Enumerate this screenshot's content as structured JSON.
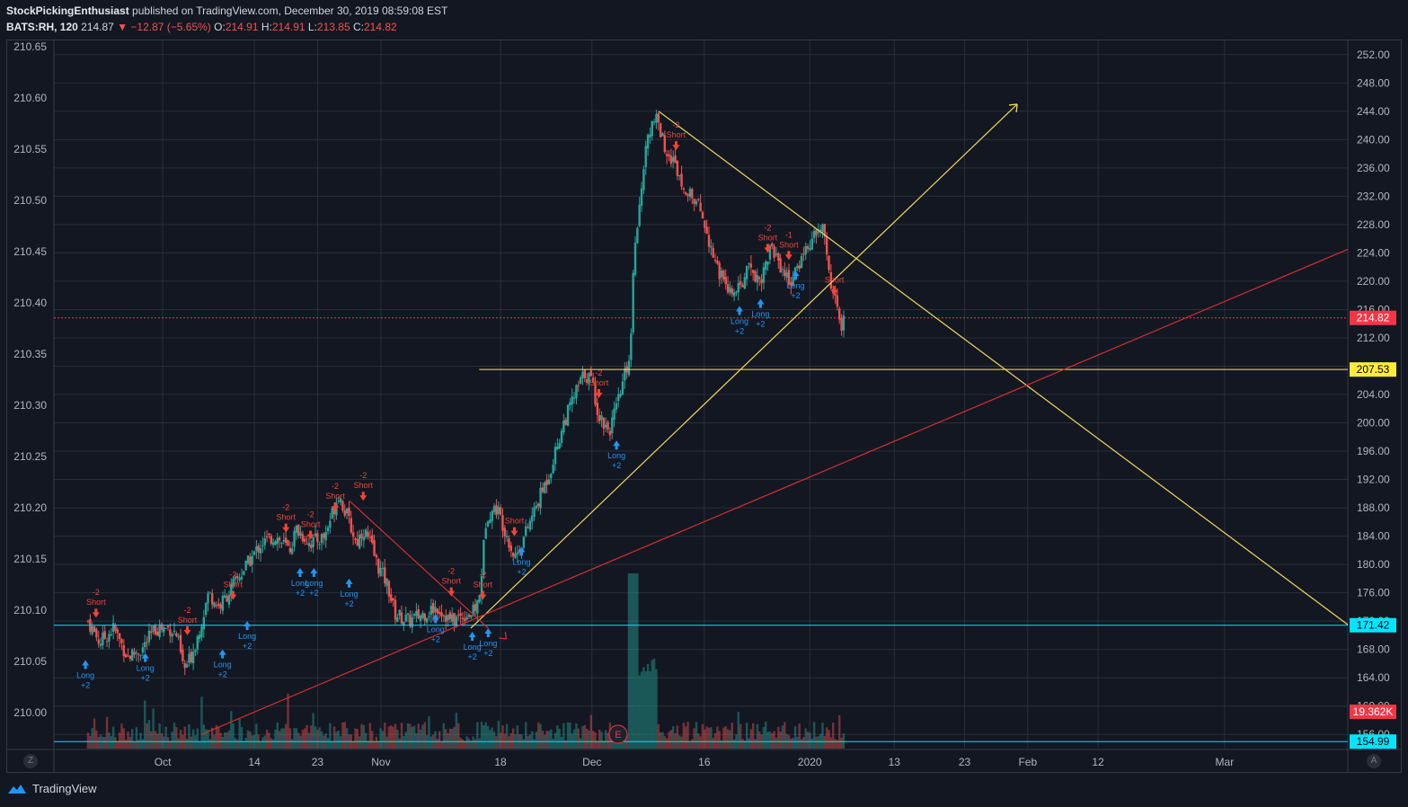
{
  "header": {
    "author": "StockPickingEnthusiast",
    "published_text": "published on TradingView.com, December 30, 2019 08:59:08 EST",
    "symbol": "BATS:RH, 120",
    "last": "214.87",
    "change": "▼ −12.87 (−5.65%)",
    "o_label": "O:",
    "o": "214.91",
    "h_label": "H:",
    "h": "214.91",
    "l_label": "L:",
    "l": "213.85",
    "c_label": "C:",
    "c": "214.82"
  },
  "footer": {
    "brand": "TradingView",
    "z_button": "Z",
    "a_button": "A"
  },
  "colors": {
    "background": "#131722",
    "grid": "#2a2e39",
    "up": "#26a69a",
    "down": "#ef5350",
    "trend_yellow": "#f0d85b",
    "trend_red": "#d32f2f",
    "support_cyan": "#4dd0e1",
    "long_marker": "#2196f3",
    "short_marker": "#f44336"
  },
  "chart_data": {
    "type": "candlestick",
    "left_axis": {
      "ticks": [
        "210.65",
        "210.60",
        "210.55",
        "210.50",
        "210.45",
        "210.40",
        "210.35",
        "210.30",
        "210.25",
        "210.20",
        "210.15",
        "210.10",
        "210.05",
        "210.00"
      ]
    },
    "right_axis": {
      "ticks": [
        "252.00",
        "248.00",
        "244.00",
        "240.00",
        "236.00",
        "232.00",
        "228.00",
        "224.00",
        "220.00",
        "216.00",
        "212.00",
        "208.00",
        "204.00",
        "200.00",
        "196.00",
        "192.00",
        "188.00",
        "184.00",
        "180.00",
        "176.00",
        "172.00",
        "168.00",
        "164.00",
        "160.00",
        "156.00"
      ],
      "ylim": [
        154,
        254
      ],
      "price_labels": [
        {
          "text": "214.82",
          "value": 214.82,
          "color": "#f23645",
          "text_color": "#ffffff"
        },
        {
          "text": "207.53",
          "value": 207.53,
          "color": "#ffeb3b",
          "text_color": "#000000"
        },
        {
          "text": "171.42",
          "value": 171.42,
          "color": "#00e5ff",
          "text_color": "#000000"
        },
        {
          "text": "19.362K",
          "value": 159.2,
          "color": "#f23645",
          "text_color": "#ffffff"
        },
        {
          "text": "154.99",
          "value": 154.99,
          "color": "#00e5ff",
          "text_color": "#000000"
        }
      ]
    },
    "x_axis": {
      "labels": [
        "Oct",
        "14",
        "23",
        "Nov",
        "18",
        "Dec",
        "16",
        "2020",
        "13",
        "23",
        "Feb",
        "12",
        "Mar"
      ],
      "label_values": [
        2019.7479,
        2019.7836,
        2019.8082,
        2019.8329,
        2019.8795,
        2019.9151,
        2019.9589,
        2020.0,
        2020.0329,
        2020.0603,
        2020.0849,
        2020.1123,
        2020.1616
      ]
    },
    "ohlc_points": [
      [
        2019.7188,
        172
      ],
      [
        2019.7233,
        169
      ],
      [
        2019.7288,
        171
      ],
      [
        2019.7342,
        167
      ],
      [
        2019.7397,
        168
      ],
      [
        2019.7452,
        171
      ],
      [
        2019.7507,
        171
      ],
      [
        2019.7534,
        170
      ],
      [
        2019.7562,
        165
      ],
      [
        2019.7589,
        167
      ],
      [
        2019.7616,
        170
      ],
      [
        2019.7658,
        176
      ],
      [
        2019.7699,
        174
      ],
      [
        2019.7753,
        177
      ],
      [
        2019.7808,
        180
      ],
      [
        2019.7863,
        183
      ],
      [
        2019.7918,
        184
      ],
      [
        2019.7973,
        182
      ],
      [
        2019.8,
        185
      ],
      [
        2019.8055,
        183
      ],
      [
        2019.811,
        184
      ],
      [
        2019.8164,
        190
      ],
      [
        2019.8205,
        186
      ],
      [
        2019.8233,
        183
      ],
      [
        2019.826,
        185
      ],
      [
        2019.8288,
        183
      ],
      [
        2019.8315,
        180
      ],
      [
        2019.8356,
        177
      ],
      [
        2019.8384,
        173
      ],
      [
        2019.8438,
        172
      ],
      [
        2019.8493,
        173
      ],
      [
        2019.8548,
        174
      ],
      [
        2019.8603,
        172
      ],
      [
        2019.8658,
        173
      ],
      [
        2019.8685,
        173
      ],
      [
        2019.8712,
        175
      ],
      [
        2019.874,
        187
      ],
      [
        2019.8781,
        188
      ],
      [
        2019.8822,
        184
      ],
      [
        2019.8849,
        181
      ],
      [
        2019.8877,
        183
      ],
      [
        2019.8932,
        188
      ],
      [
        2019.8986,
        193
      ],
      [
        2019.9041,
        200
      ],
      [
        2019.9096,
        205
      ],
      [
        2019.9123,
        207
      ],
      [
        2019.9151,
        206
      ],
      [
        2019.9178,
        201
      ],
      [
        2019.9219,
        199
      ],
      [
        2019.9247,
        202
      ],
      [
        2019.9274,
        206
      ],
      [
        2019.9301,
        210
      ],
      [
        2019.9315,
        225
      ],
      [
        2019.9342,
        232
      ],
      [
        2019.937,
        241
      ],
      [
        2019.9397,
        243
      ],
      [
        2019.9438,
        239
      ],
      [
        2019.9479,
        236
      ],
      [
        2019.9534,
        232
      ],
      [
        2019.9575,
        230
      ],
      [
        2019.963,
        223
      ],
      [
        2019.9671,
        219
      ],
      [
        2019.9712,
        218
      ],
      [
        2019.9767,
        222
      ],
      [
        2019.9808,
        220
      ],
      [
        2019.9849,
        225
      ],
      [
        2019.989,
        222
      ],
      [
        2019.9918,
        220
      ],
      [
        2019.9945,
        221
      ],
      [
        2019.9973,
        224
      ],
      [
        2020.0014,
        226
      ],
      [
        2020.0055,
        228
      ],
      [
        2020.0068,
        222
      ],
      [
        2020.0096,
        218
      ],
      [
        2020.0123,
        213
      ],
      [
        2020.0137,
        215
      ]
    ],
    "trend_lines": [
      {
        "color": "#f0d85b",
        "from": [
          2019.8679,
          171.0
        ],
        "to": [
          2020.0808,
          245.0
        ]
      },
      {
        "color": "#f0d85b",
        "from": [
          2019.9411,
          244.0
        ],
        "to": [
          2020.2096,
          171.5
        ]
      },
      {
        "color": "#d32f2f",
        "from": [
          2019.763,
          156.0
        ],
        "to": [
          2020.2096,
          224.5
        ]
      },
      {
        "color": "#d32f2f",
        "from": [
          2019.8206,
          189.0
        ],
        "to": [
          2019.8747,
          171.0
        ]
      }
    ],
    "horizontal_levels": [
      {
        "value": 207.53,
        "color": "#ffeb3b",
        "from_x": 2019.8712,
        "dashed": false
      },
      {
        "value": 171.42,
        "color": "#00e5ff",
        "from_x": 2019.7055,
        "dashed": false
      },
      {
        "value": 214.82,
        "color": "#f23645",
        "from_x": 2019.7055,
        "dashed": true
      },
      {
        "value": 154.99,
        "color": "#00e5ff",
        "from_x": 2019.7055,
        "dashed": false
      }
    ],
    "signal_markers": [
      {
        "kind": "long",
        "x": 2019.7178,
        "value": 166.5,
        "labels": [
          "Long",
          "+2"
        ]
      },
      {
        "kind": "long",
        "x": 2019.7411,
        "value": 167.5,
        "labels": [
          "Long",
          "+2"
        ]
      },
      {
        "kind": "long",
        "x": 2019.7712,
        "value": 168.0,
        "labels": [
          "Long",
          "+2"
        ]
      },
      {
        "kind": "long",
        "x": 2019.7808,
        "value": 172.0,
        "labels": [
          "Long",
          "+2"
        ]
      },
      {
        "kind": "long",
        "x": 2019.8014,
        "value": 179.5,
        "labels": [
          "Long",
          "+2"
        ]
      },
      {
        "kind": "long",
        "x": 2019.8068,
        "value": 179.5,
        "labels": [
          "Long",
          "+2"
        ]
      },
      {
        "kind": "long",
        "x": 2019.8205,
        "value": 178.0,
        "labels": [
          "Long",
          "+2"
        ]
      },
      {
        "kind": "long",
        "x": 2019.8542,
        "value": 173.0,
        "labels": [
          "Long",
          "+2"
        ]
      },
      {
        "kind": "long",
        "x": 2019.8685,
        "value": 170.5,
        "labels": [
          "Long",
          "+2"
        ]
      },
      {
        "kind": "long",
        "x": 2019.8747,
        "value": 171.0,
        "labels": [
          "Long",
          "+2"
        ]
      },
      {
        "kind": "long",
        "x": 2019.8877,
        "value": 182.5,
        "labels": [
          "Long",
          "+2"
        ]
      },
      {
        "kind": "long",
        "x": 2019.9247,
        "value": 197.5,
        "labels": [
          "Long",
          "+2"
        ]
      },
      {
        "kind": "long",
        "x": 2019.9726,
        "value": 216.5,
        "labels": [
          "Long",
          "+2"
        ]
      },
      {
        "kind": "long",
        "x": 2019.9808,
        "value": 217.5,
        "labels": [
          "Long",
          "+2"
        ]
      },
      {
        "kind": "long",
        "x": 2019.9945,
        "value": 221.5,
        "labels": [
          "Long",
          "+2"
        ]
      },
      {
        "kind": "short",
        "x": 2019.7219,
        "value": 172.5,
        "labels": [
          "-2",
          "Short"
        ]
      },
      {
        "kind": "short",
        "x": 2019.7575,
        "value": 170.0,
        "labels": [
          "-2",
          "Short"
        ]
      },
      {
        "kind": "short",
        "x": 2019.7753,
        "value": 175.0,
        "labels": [
          "-2",
          "Short"
        ]
      },
      {
        "kind": "short",
        "x": 2019.7959,
        "value": 184.5,
        "labels": [
          "-2",
          "Short"
        ]
      },
      {
        "kind": "short",
        "x": 2019.8055,
        "value": 183.5,
        "labels": [
          "-2",
          "Short"
        ]
      },
      {
        "kind": "short",
        "x": 2019.8151,
        "value": 187.5,
        "labels": [
          "-2",
          "Short"
        ]
      },
      {
        "kind": "short",
        "x": 2019.826,
        "value": 189.0,
        "labels": [
          "-2",
          "Short"
        ]
      },
      {
        "kind": "short",
        "x": 2019.8603,
        "value": 175.5,
        "labels": [
          "-2",
          "Short"
        ]
      },
      {
        "kind": "short",
        "x": 2019.8726,
        "value": 175.0,
        "labels": [
          "-2",
          "Short"
        ]
      },
      {
        "kind": "short",
        "x": 2019.8849,
        "value": 184.0,
        "labels": [
          "Short"
        ]
      },
      {
        "kind": "short",
        "x": 2019.9178,
        "value": 203.5,
        "labels": [
          "-2",
          "Short"
        ]
      },
      {
        "kind": "short",
        "x": 2019.9479,
        "value": 238.5,
        "labels": [
          "-2",
          "Short"
        ]
      },
      {
        "kind": "short",
        "x": 2019.9836,
        "value": 224.0,
        "labels": [
          "-2",
          "Short"
        ]
      },
      {
        "kind": "short",
        "x": 2019.9918,
        "value": 223.0,
        "labels": [
          "-1",
          "Short"
        ]
      },
      {
        "kind": "short",
        "x": 2020.0096,
        "value": 218.0,
        "labels": [
          "Short"
        ]
      }
    ],
    "earnings_marker": {
      "x": 2019.9253,
      "label": "E"
    },
    "grid": true
  }
}
